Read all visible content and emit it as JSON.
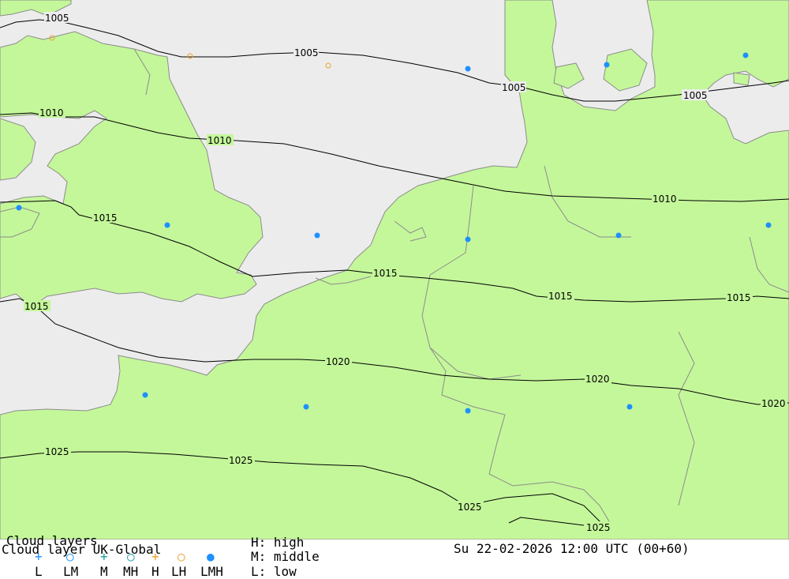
{
  "map": {
    "isobars": [
      "1005",
      "1005",
      "1005",
      "1005",
      "1010",
      "1010",
      "1010",
      "1015",
      "1015",
      "1015",
      "1015",
      "1015",
      "1020",
      "1020",
      "1020",
      "1020",
      "1025",
      "1025",
      "1025",
      "1025"
    ],
    "colors": {
      "sea": "#ececec",
      "land": "#c4f79a",
      "border": "#8c8c8c",
      "isobar": "#000000",
      "cloud_dot": "#1e90ff",
      "high_marker": "#f0a030"
    }
  },
  "legend": {
    "title": "Cloud layers",
    "product": "Cloud layer  UK-Global",
    "keys": [
      "L",
      "LM",
      "M",
      "MH",
      "H",
      "LH",
      "LMH"
    ],
    "levels": [
      "H: high",
      "M: middle",
      "L: low"
    ],
    "timestamp": "Su 22-02-2026 12:00 UTC (00+60)"
  }
}
